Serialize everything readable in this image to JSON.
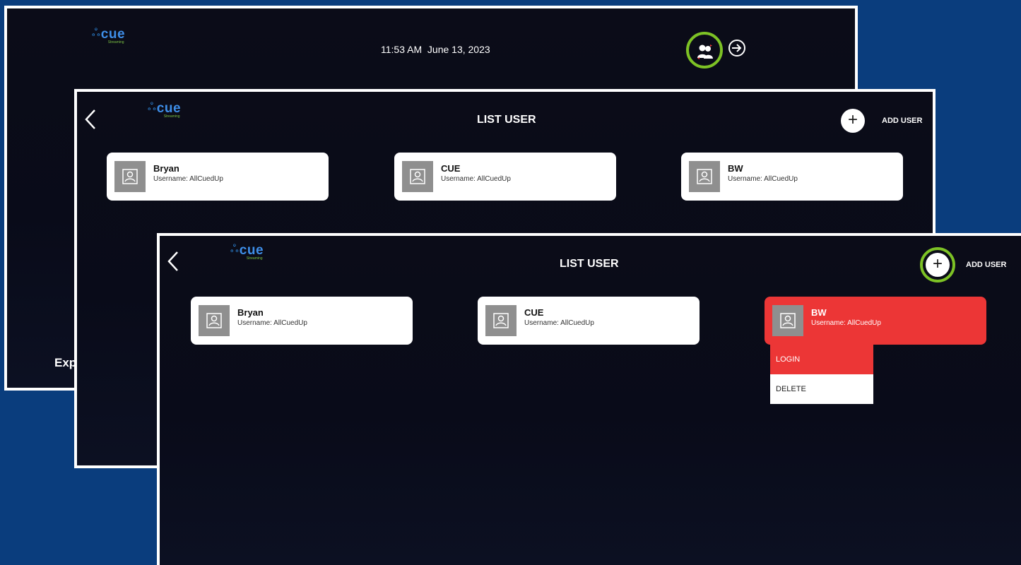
{
  "back_screen": {
    "logo": {
      "word": "cue",
      "sub": "Streaming"
    },
    "time": "11:53 AM",
    "date": "June 13, 2023",
    "footer_text": "Exp",
    "icons": [
      "switch-user-icon",
      "login-arrow-icon"
    ]
  },
  "list_screen": {
    "logo": {
      "word": "cue",
      "sub": "Streaming"
    },
    "title": "LIST USER",
    "add_label": "ADD USER",
    "add_symbol": "+",
    "users": [
      {
        "name": "Bryan",
        "username": "Username: AllCuedUp"
      },
      {
        "name": "CUE",
        "username": "Username: AllCuedUp"
      },
      {
        "name": "BW",
        "username": "Username: AllCuedUp"
      }
    ]
  },
  "front_screen": {
    "logo": {
      "word": "cue",
      "sub": "Streaming"
    },
    "title": "LIST USER",
    "add_label": "ADD USER",
    "add_symbol": "+",
    "users": [
      {
        "name": "Bryan",
        "username": "Username: AllCuedUp"
      },
      {
        "name": "CUE",
        "username": "Username: AllCuedUp"
      },
      {
        "name": "BW",
        "username": "Username: AllCuedUp"
      }
    ],
    "menu": {
      "login": "LOGIN",
      "delete": "DELETE"
    }
  },
  "colors": {
    "background": "#0a3d7d",
    "highlight": "#7dc225",
    "selected": "#ec3636",
    "logo_blue": "#3e8ee8",
    "logo_green": "#7bc143"
  }
}
